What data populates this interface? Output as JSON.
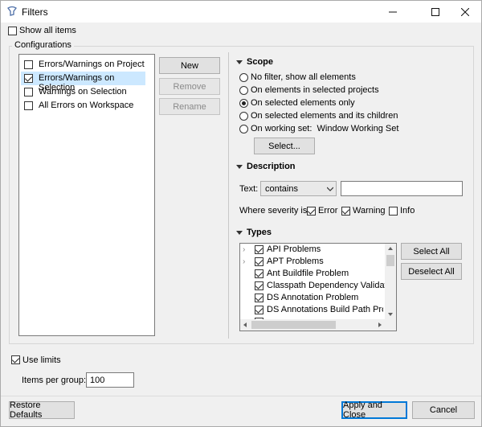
{
  "window": {
    "title": "Filters",
    "icon": "filters-app-icon"
  },
  "show_all_items": {
    "label": "Show all items",
    "checked": false
  },
  "configurations": {
    "label": "Configurations",
    "items": [
      {
        "label": "Errors/Warnings on Project",
        "checked": false,
        "selected": false
      },
      {
        "label": "Errors/Warnings on Selection",
        "checked": true,
        "selected": true
      },
      {
        "label": "Warnings on Selection",
        "checked": false,
        "selected": false
      },
      {
        "label": "All Errors on Workspace",
        "checked": false,
        "selected": false
      }
    ],
    "buttons": {
      "new": "New",
      "remove": "Remove",
      "rename": "Rename"
    }
  },
  "scope": {
    "label": "Scope",
    "options": [
      {
        "label": "No filter, show all elements",
        "selected": false
      },
      {
        "label": "On elements in selected projects",
        "selected": false
      },
      {
        "label": "On selected elements only",
        "selected": true
      },
      {
        "label": "On selected elements and its children",
        "selected": false
      },
      {
        "label": "On working set:  Window Working Set",
        "selected": false
      }
    ],
    "select_button": "Select..."
  },
  "description": {
    "label": "Description",
    "text_label": "Text:",
    "text_mode": "contains",
    "text_value": "",
    "severity_label": "Where severity is:",
    "severity": [
      {
        "label": "Error",
        "checked": true
      },
      {
        "label": "Warning",
        "checked": true
      },
      {
        "label": "Info",
        "checked": false
      }
    ]
  },
  "types": {
    "label": "Types",
    "items": [
      {
        "label": "API Problems",
        "checked": true,
        "expandable": true
      },
      {
        "label": "APT Problems",
        "checked": true,
        "expandable": true
      },
      {
        "label": "Ant Buildfile Problem",
        "checked": true,
        "expandable": false
      },
      {
        "label": "Classpath Dependency Validator",
        "checked": true,
        "expandable": false
      },
      {
        "label": "DS Annotation Problem",
        "checked": true,
        "expandable": false
      },
      {
        "label": "DS Annotations Build Path Problem",
        "checked": true,
        "expandable": false
      }
    ],
    "select_all": "Select All",
    "deselect_all": "Deselect All"
  },
  "limits": {
    "use_limits_label": "Use limits",
    "use_limits_checked": true,
    "items_per_group_label": "Items per group:",
    "items_per_group_value": "100"
  },
  "footer": {
    "restore_defaults": "Restore Defaults",
    "apply_and_close": "Apply and Close",
    "cancel": "Cancel"
  },
  "colors": {
    "accent": "#0078d7",
    "selection": "#cce8ff"
  }
}
